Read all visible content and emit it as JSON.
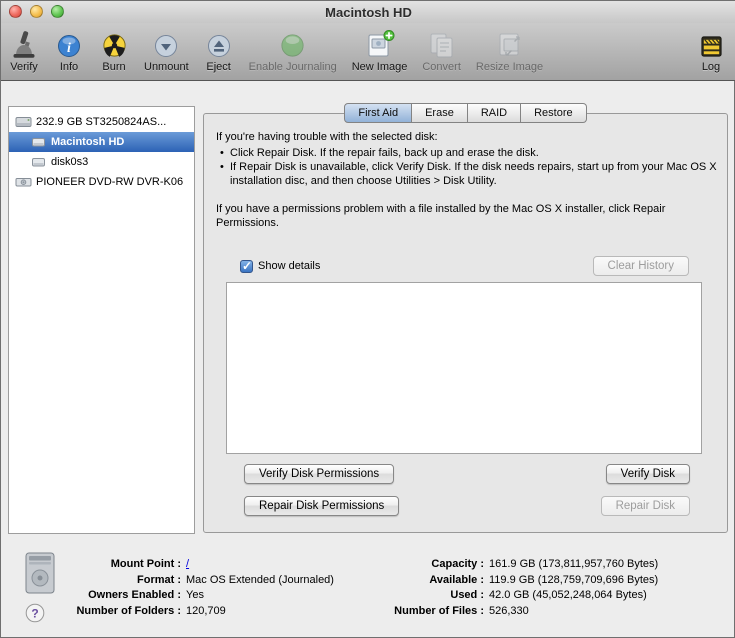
{
  "window": {
    "title": "Macintosh HD"
  },
  "accent_colors": {
    "selection_blue": "#2c62b5",
    "tab_selected": "#92b2d8",
    "burn_yellow": "#f6d33c"
  },
  "toolbar": {
    "items": [
      {
        "label": "Verify",
        "icon": "microscope-icon",
        "enabled": true
      },
      {
        "label": "Info",
        "icon": "info-icon",
        "enabled": true
      },
      {
        "label": "Burn",
        "icon": "burn-icon",
        "enabled": true
      },
      {
        "label": "Unmount",
        "icon": "unmount-icon",
        "enabled": true
      },
      {
        "label": "Eject",
        "icon": "eject-icon",
        "enabled": true
      },
      {
        "label": "Enable Journaling",
        "icon": "journaling-icon",
        "enabled": false
      },
      {
        "label": "New Image",
        "icon": "new-image-icon",
        "enabled": true
      },
      {
        "label": "Convert",
        "icon": "convert-icon",
        "enabled": false
      },
      {
        "label": "Resize Image",
        "icon": "resize-image-icon",
        "enabled": false
      }
    ],
    "log": {
      "label": "Log",
      "icon": "log-icon",
      "enabled": true
    }
  },
  "sidebar": {
    "items": [
      {
        "label": "232.9 GB ST3250824AS...",
        "icon": "disk-icon",
        "level": 0,
        "selected": false
      },
      {
        "label": "Macintosh HD",
        "icon": "volume-icon",
        "level": 1,
        "selected": true
      },
      {
        "label": "disk0s3",
        "icon": "volume-icon",
        "level": 1,
        "selected": false
      },
      {
        "label": "PIONEER DVD-RW DVR-K06",
        "icon": "optical-drive-icon",
        "level": 0,
        "selected": false
      }
    ]
  },
  "tabs": [
    {
      "label": "First Aid",
      "selected": true
    },
    {
      "label": "Erase",
      "selected": false
    },
    {
      "label": "RAID",
      "selected": false
    },
    {
      "label": "Restore",
      "selected": false
    }
  ],
  "first_aid": {
    "intro": "If you're having trouble with the selected disk:",
    "bullets": [
      "Click Repair Disk. If the repair fails, back up and erase the disk.",
      "If Repair Disk is unavailable, click Verify Disk. If the disk needs repairs, start up from your Mac OS X installation disc, and then choose Utilities > Disk Utility."
    ],
    "permissions_note": "If you have a permissions problem with a file installed by the Mac OS X installer, click Repair Permissions.",
    "show_details_label": "Show details",
    "show_details_checked": true,
    "clear_history_label": "Clear History",
    "verify_permissions_label": "Verify Disk Permissions",
    "verify_disk_label": "Verify Disk",
    "repair_permissions_label": "Repair Disk Permissions",
    "repair_disk_label": "Repair Disk",
    "output_text": ""
  },
  "info": {
    "left": [
      {
        "label": "Mount Point :",
        "value": "/",
        "link": true
      },
      {
        "label": "Format :",
        "value": "Mac OS Extended (Journaled)",
        "link": false
      },
      {
        "label": "Owners Enabled :",
        "value": "Yes",
        "link": false
      },
      {
        "label": "Number of Folders :",
        "value": "120,709",
        "link": false
      }
    ],
    "right": [
      {
        "label": "Capacity :",
        "value": "161.9 GB (173,811,957,760 Bytes)",
        "link": false
      },
      {
        "label": "Available :",
        "value": "119.9 GB (128,759,709,696 Bytes)",
        "link": false
      },
      {
        "label": "Used :",
        "value": "42.0 GB (45,052,248,064 Bytes)",
        "link": false
      },
      {
        "label": "Number of Files :",
        "value": "526,330",
        "link": false
      }
    ]
  }
}
